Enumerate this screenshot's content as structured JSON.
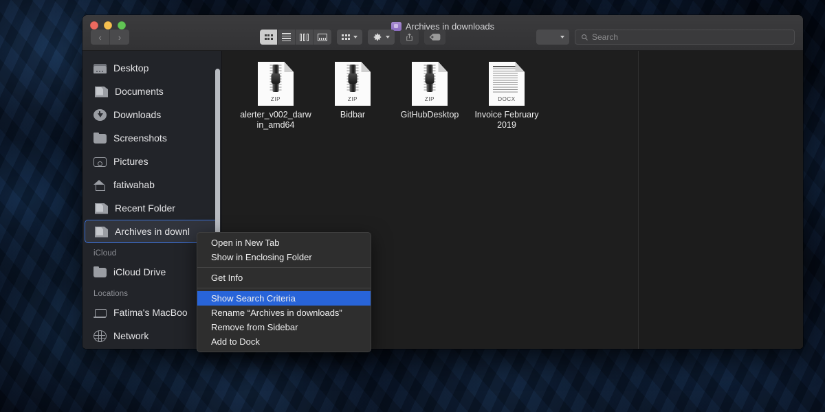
{
  "window": {
    "title": "Archives in downloads",
    "title_icon": "smart-folder-icon",
    "traffic_lights": [
      "close",
      "minimize",
      "zoom"
    ]
  },
  "toolbar": {
    "back_label": "‹",
    "forward_label": "›",
    "view_modes": [
      {
        "name": "icon-view",
        "active": true
      },
      {
        "name": "list-view",
        "active": false
      },
      {
        "name": "column-view",
        "active": false
      },
      {
        "name": "gallery-view",
        "active": false
      }
    ],
    "group_button": "arrange-icon",
    "action_button": "gear-icon",
    "share_button": "share-icon",
    "tag_button": "tag-icon",
    "search_scope_label": "",
    "search_placeholder": "Search",
    "search_value": ""
  },
  "sidebar": {
    "favorites": [
      {
        "label": "Desktop",
        "icon": "desktop-icon",
        "icon_class": "ic-desktop"
      },
      {
        "label": "Documents",
        "icon": "documents-icon",
        "icon_class": "ic-doc"
      },
      {
        "label": "Downloads",
        "icon": "downloads-icon",
        "icon_class": "ic-down"
      },
      {
        "label": "Screenshots",
        "icon": "folder-icon",
        "icon_class": "ic-folder"
      },
      {
        "label": "Pictures",
        "icon": "pictures-icon",
        "icon_class": "ic-pic"
      },
      {
        "label": "fatiwahab",
        "icon": "home-icon",
        "icon_class": "ic-home"
      },
      {
        "label": "Recent Folder",
        "icon": "smart-folder-icon",
        "icon_class": "ic-doc"
      },
      {
        "label": "Archives in downl",
        "icon": "smart-folder-icon",
        "icon_class": "ic-doc",
        "selected": true
      }
    ],
    "icloud_header": "iCloud",
    "icloud": [
      {
        "label": "iCloud Drive",
        "icon": "folder-icon",
        "icon_class": "ic-folder"
      }
    ],
    "locations_header": "Locations",
    "locations": [
      {
        "label": "Fatima's MacBoo",
        "icon": "laptop-icon",
        "icon_class": "ic-laptop"
      },
      {
        "label": "Network",
        "icon": "network-icon",
        "icon_class": "ic-net"
      }
    ]
  },
  "files": [
    {
      "name": "alerter_v002_darwin_amd64",
      "ext": "ZIP",
      "kind": "zip"
    },
    {
      "name": "Bidbar",
      "ext": "ZIP",
      "kind": "zip"
    },
    {
      "name": "GitHubDesktop",
      "ext": "ZIP",
      "kind": "zip"
    },
    {
      "name": "Invoice February 2019",
      "ext": "DOCX",
      "kind": "docx"
    }
  ],
  "context_menu": {
    "items": [
      {
        "label": "Open in New Tab",
        "highlight": false
      },
      {
        "label": "Show in Enclosing Folder",
        "highlight": false
      },
      {
        "separator": true
      },
      {
        "label": "Get Info",
        "highlight": false
      },
      {
        "separator": true
      },
      {
        "label": "Show Search Criteria",
        "highlight": true
      },
      {
        "label": "Rename “Archives in downloads”",
        "highlight": false
      },
      {
        "label": "Remove from Sidebar",
        "highlight": false
      },
      {
        "label": "Add to Dock",
        "highlight": false
      }
    ]
  },
  "colors": {
    "highlight_blue": "#2864d8",
    "selection_border": "#3b6fd4",
    "sidebar_bg": "#222429",
    "content_bg": "#1e1e1e",
    "titlebar_bg": "#343436",
    "smart_folder_purple": "#8b6cc0"
  }
}
